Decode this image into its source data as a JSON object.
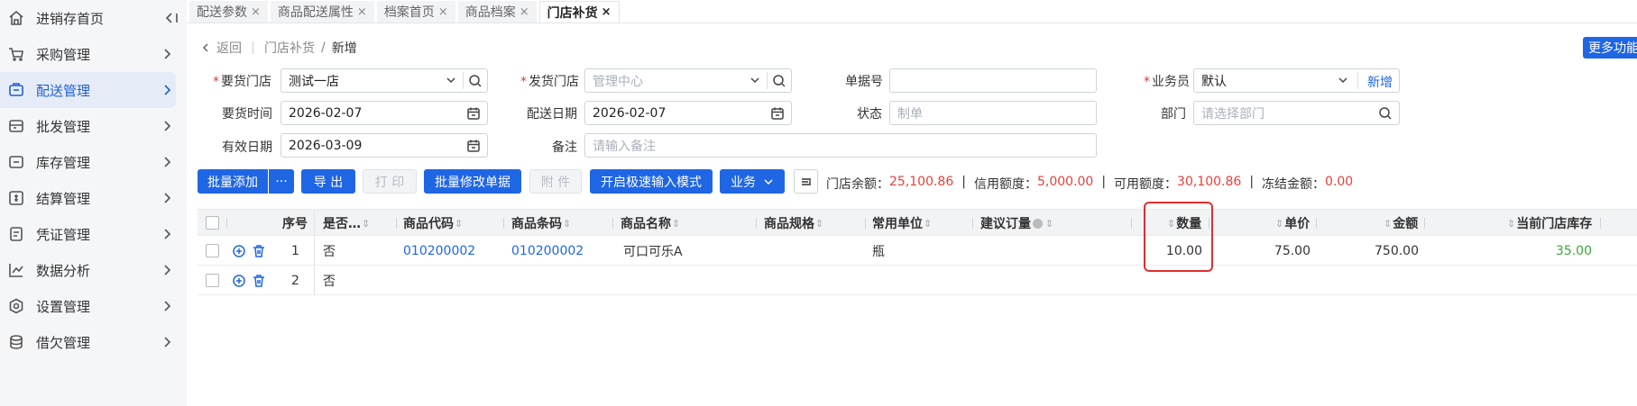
{
  "sidebar": {
    "items": [
      {
        "label": "进销存首页",
        "icon": "home-icon"
      },
      {
        "label": "采购管理",
        "icon": "cart-icon"
      },
      {
        "label": "配送管理",
        "icon": "delivery-icon"
      },
      {
        "label": "批发管理",
        "icon": "wholesale-icon"
      },
      {
        "label": "库存管理",
        "icon": "inventory-icon"
      },
      {
        "label": "结算管理",
        "icon": "settlement-icon"
      },
      {
        "label": "凭证管理",
        "icon": "voucher-icon"
      },
      {
        "label": "数据分析",
        "icon": "chart-icon"
      },
      {
        "label": "设置管理",
        "icon": "settings-icon"
      },
      {
        "label": "借欠管理",
        "icon": "debt-icon"
      }
    ],
    "active_index": 2
  },
  "tabs": [
    {
      "label": "配送参数"
    },
    {
      "label": "商品配送属性"
    },
    {
      "label": "档案首页"
    },
    {
      "label": "商品档案"
    },
    {
      "label": "门店补货"
    }
  ],
  "tab_close": "×",
  "breadcrumb": {
    "back": "返回",
    "parent": "门店补货",
    "slash": "/",
    "current": "新增"
  },
  "more_button": "更多功能",
  "form": {
    "req_store": {
      "label": "要货门店",
      "value": "测试一店"
    },
    "ship_store": {
      "label": "发货门店",
      "placeholder": "管理中心"
    },
    "doc_no": {
      "label": "单据号",
      "value": ""
    },
    "salesman": {
      "label": "业务员",
      "value": "默认",
      "add": "新增"
    },
    "req_time": {
      "label": "要货时间",
      "value": "2026-02-07"
    },
    "ship_date": {
      "label": "配送日期",
      "value": "2026-02-07"
    },
    "status": {
      "label": "状态",
      "placeholder": "制单"
    },
    "dept": {
      "label": "部门",
      "placeholder": "请选择部门"
    },
    "valid_date": {
      "label": "有效日期",
      "value": "2026-03-09"
    },
    "remark": {
      "label": "备注",
      "placeholder": "请输入备注"
    }
  },
  "toolbar": {
    "batch_add": "批量添加",
    "more": "···",
    "export": "导 出",
    "print": "打 印",
    "batch_modify": "批量修改单据",
    "attachment": "附 件",
    "fast_input": "开启极速输入模式",
    "business": "业务"
  },
  "summary": {
    "store_balance_label": "门店余额：",
    "store_balance": "25,100.86",
    "credit_label": "信用额度：",
    "credit": "5,000.00",
    "available_label": "可用额度：",
    "available": "30,100.86",
    "frozen_label": "冻结金额：",
    "frozen": "0.00",
    "sep": "|"
  },
  "table": {
    "headers": {
      "seq": "序号",
      "is_gift": "是否…",
      "code": "商品代码",
      "barcode": "商品条码",
      "name": "商品名称",
      "spec": "商品规格",
      "unit": "常用单位",
      "suggest": "建议订量",
      "qty": "数量",
      "price": "单价",
      "amount": "金额",
      "stock": "当前门店库存"
    },
    "rows": [
      {
        "seq": "1",
        "is_gift": "否",
        "code": "010200002",
        "barcode": "010200002",
        "name": "可口可乐A",
        "spec": "",
        "unit": "瓶",
        "suggest": "",
        "qty": "10.00",
        "price": "75.00",
        "amount": "750.00",
        "stock": "35.00"
      },
      {
        "seq": "2",
        "is_gift": "否",
        "code": "",
        "barcode": "",
        "name": "",
        "spec": "",
        "unit": "",
        "suggest": "",
        "qty": "",
        "price": "",
        "amount": "",
        "stock": ""
      }
    ]
  },
  "colors": {
    "accent": "#1f66e5",
    "danger": "#e53935",
    "stock_green": "#3aa83a",
    "highlight": "#e02f2f"
  }
}
